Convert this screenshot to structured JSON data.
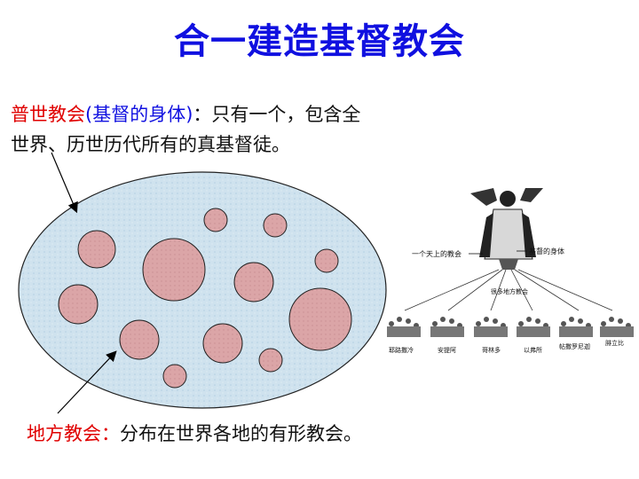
{
  "title": "合一建造基督教会",
  "universal": {
    "term": "普世教会",
    "paren": "(基督的身体)",
    "desc_line1": "：只有一个，包含全",
    "desc_line2": "世界、历世历代所有的真基督徒。"
  },
  "local": {
    "term": "地方教会：",
    "desc": "分布在世界各地的有形教会。"
  },
  "illustration": {
    "label_left": "一个天上的教会",
    "label_right": "基督的身体",
    "label_center": "很多地方教会",
    "cities": [
      "耶路撒冷",
      "安提阿",
      "哥林多",
      "以弗所",
      "帖撒罗尼迦",
      "腓立比"
    ]
  },
  "colors": {
    "ellipse_fill": "#cfe2ee",
    "circle_fill": "#dba5a7",
    "title": "#1010e0",
    "accent": "#e00000"
  }
}
